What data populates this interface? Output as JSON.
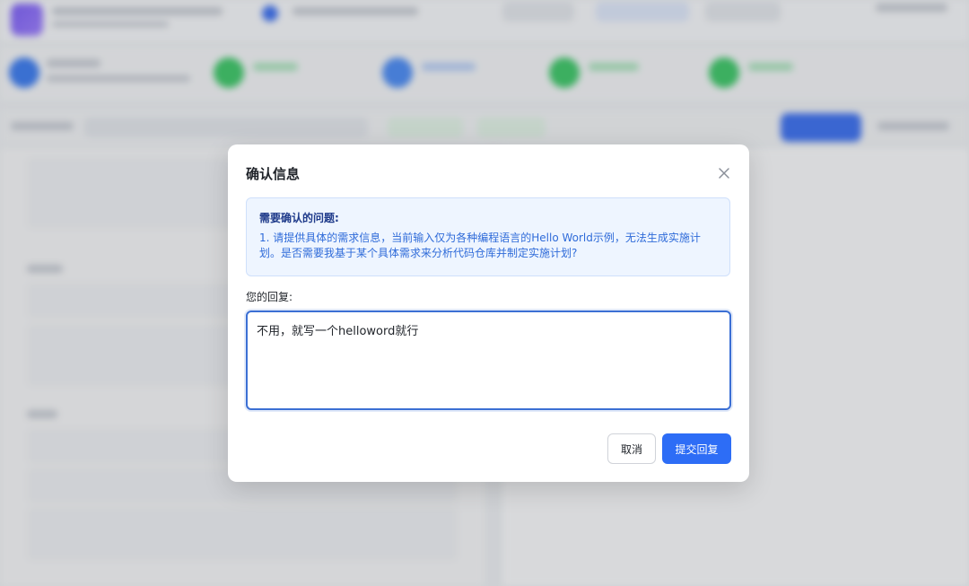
{
  "dialog": {
    "title": "确认信息",
    "question_heading": "需要确认的问题:",
    "question_text": "1. 请提供具体的需求信息，当前输入仅为各种编程语言的Hello World示例，无法生成实施计划。是否需要我基于某个具体需求来分析代码仓库并制定实施计划?",
    "reply_label": "您的回复:",
    "reply_value": "不用，就写一个helloword就行",
    "cancel_label": "取消",
    "submit_label": "提交回复"
  },
  "colors": {
    "accent": "#2d6df6",
    "question_bg": "#eef5ff",
    "question_text": "#2f6bd9"
  },
  "icons": {
    "close": "close-icon"
  }
}
